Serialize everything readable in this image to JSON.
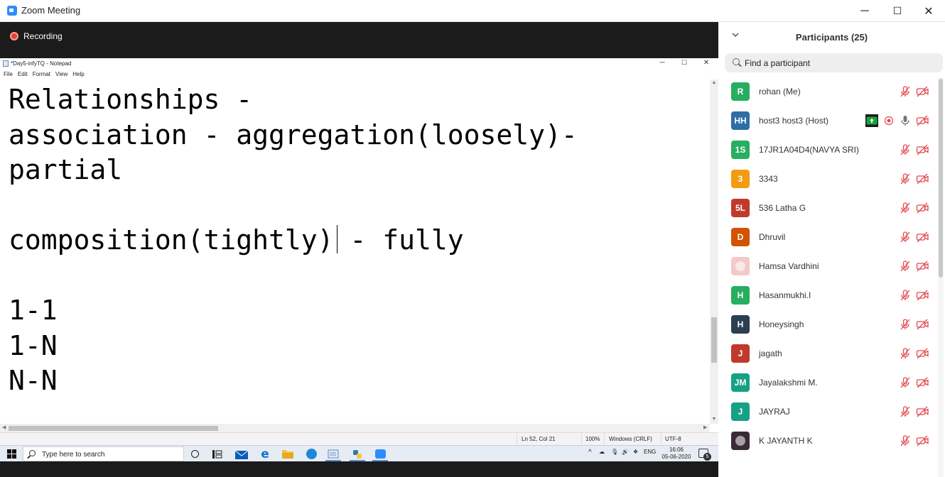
{
  "window": {
    "title": "Zoom Meeting",
    "minimize": "─",
    "maximize": "☐",
    "close": "✕"
  },
  "recording": {
    "label": "Recording"
  },
  "notepad": {
    "title": "*Day5-infyTQ - Notepad",
    "menu": [
      "File",
      "Edit",
      "Format",
      "View",
      "Help"
    ],
    "lines": [
      "Relationships -",
      "association - aggregation(loosely)-",
      "partial",
      "",
      "composition(tightly)",
      " - fully",
      "",
      "1-1",
      "1-N",
      "N-N"
    ],
    "status": {
      "position": "Ln 52, Col 21",
      "zoom": "100%",
      "line_ending": "Windows (CRLF)",
      "encoding": "UTF-8"
    }
  },
  "taskbar": {
    "search_placeholder": "Type here to search",
    "language": "ENG",
    "time": "16:06",
    "date": "05-06-2020",
    "notifications": "5",
    "tray_up": "^"
  },
  "participants": {
    "title": "Participants (25)",
    "search_placeholder": "Find a participant",
    "colors": {
      "muted": "#e5484d",
      "host_share": "#1aa33c"
    },
    "list": [
      {
        "initials": "R",
        "name": "rohan (Me)",
        "color": "#27ae60"
      },
      {
        "initials": "HH",
        "name": "host3 host3 (Host)",
        "color": "#2d6ea8",
        "host": true
      },
      {
        "initials": "1S",
        "name": "17JR1A04D4(NAVYA SRI)",
        "color": "#27ae60"
      },
      {
        "initials": "3",
        "name": "3343",
        "color": "#f39c12"
      },
      {
        "initials": "5L",
        "name": "536 Latha G",
        "color": "#c0392b"
      },
      {
        "initials": "D",
        "name": "Dhruvil",
        "color": "#d35400"
      },
      {
        "initials": "",
        "name": "Hamsa Vardhini",
        "color": "#f3c9c9",
        "photo": true
      },
      {
        "initials": "H",
        "name": "Hasanmukhi.I",
        "color": "#27ae60"
      },
      {
        "initials": "H",
        "name": "Honeysingh",
        "color": "#2c3e50"
      },
      {
        "initials": "J",
        "name": "jagath",
        "color": "#c0392b"
      },
      {
        "initials": "JM",
        "name": "Jayalakshmi M.",
        "color": "#16a085"
      },
      {
        "initials": "J",
        "name": "JAYRAJ",
        "color": "#16a085"
      },
      {
        "initials": "",
        "name": "K JAYANTH K",
        "color": "#3a2a35",
        "photo": true
      }
    ]
  }
}
